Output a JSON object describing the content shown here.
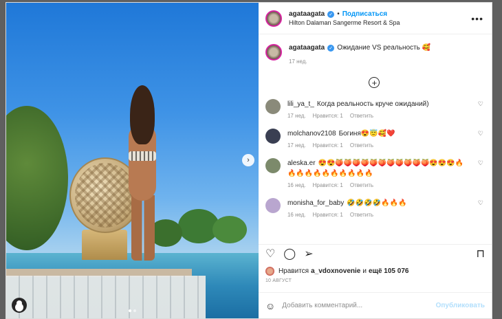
{
  "header": {
    "username": "agataagata",
    "follow_label": "Подписаться",
    "separator": "•",
    "location": "Hilton Dalaman Sangerme Resort & Spa",
    "more_label": "•••"
  },
  "caption": {
    "username": "agataagata",
    "text": "Ожидание VS реальность 🥰",
    "time": "17 нед."
  },
  "load_more_label": "+",
  "comments": [
    {
      "username": "lili_ya_t_",
      "text": "Когда реальность круче ожиданий)",
      "time": "17 нед.",
      "likes": "Нравится: 1",
      "reply": "Ответить",
      "avatar_color": "#8a8a7a"
    },
    {
      "username": "molchanov2108",
      "text": "Богиня😍😇🥰❤️",
      "time": "17 нед.",
      "likes": "Нравится: 1",
      "reply": "Ответить",
      "avatar_color": "#3a3f52"
    },
    {
      "username": "aleska.er",
      "text": "😍😍🍑🍑🍑🍑🍑🍑🍑🍑🍑🍑🍑😍😍😍🔥🔥🔥🔥🔥🔥🔥🔥🔥🔥🔥",
      "time": "16 нед.",
      "likes": "Нравится: 1",
      "reply": "Ответить",
      "avatar_color": "#7c8a6b"
    },
    {
      "username": "monisha_for_baby",
      "text": "🤣🤣🤣🤣🔥🔥🔥",
      "time": "16 нед.",
      "likes": "Нравится: 1",
      "reply": "Ответить",
      "avatar_color": "#b9a6cf"
    }
  ],
  "likes": {
    "prefix": "Нравится",
    "user": "a_vdoxnovenie",
    "suffix": "и",
    "others": "ещё 105 076"
  },
  "date": "10 АВГУСТ",
  "add_comment": {
    "placeholder": "Добавить комментарий...",
    "publish_label": "Опубликовать"
  },
  "colors": {
    "accent": "#0095f6",
    "verified": "#3897f0",
    "publish_disabled": "#b2dffc"
  }
}
